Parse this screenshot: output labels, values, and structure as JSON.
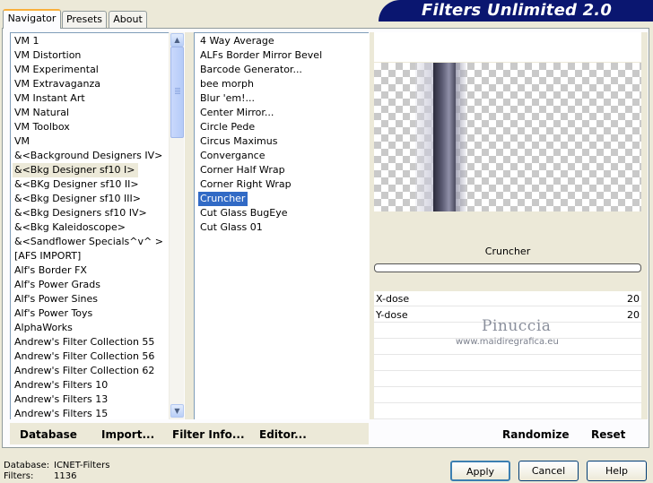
{
  "tabs": [
    "Navigator",
    "Presets",
    "About"
  ],
  "title": "Filters Unlimited 2.0",
  "categories": [
    "VM 1",
    "VM Distortion",
    "VM Experimental",
    "VM Extravaganza",
    "VM Instant Art",
    "VM Natural",
    "VM Toolbox",
    "VM",
    "&<Background Designers IV>",
    "&<Bkg Designer sf10 I>",
    "&<BKg Designer sf10 II>",
    "&<Bkg Designer sf10 III>",
    "&<Bkg Designers sf10 IV>",
    "&<Bkg Kaleidoscope>",
    "&<Sandflower Specials^v^ >",
    "[AFS IMPORT]",
    "Alf's Border FX",
    "Alf's Power Grads",
    "Alf's Power Sines",
    "Alf's Power Toys",
    "AlphaWorks",
    "Andrew's Filter Collection 55",
    "Andrew's Filter Collection 56",
    "Andrew's Filter Collection 62",
    "Andrew's Filters 10",
    "Andrew's Filters 13",
    "Andrew's Filters 15"
  ],
  "selected_category": "&<Bkg Designer sf10 I>",
  "filters": [
    "4 Way Average",
    "ALFs Border Mirror Bevel",
    "Barcode Generator...",
    "bee morph",
    "Blur 'em!...",
    "Center Mirror...",
    "Circle Pede",
    "Circus Maximus",
    "Convergance",
    "Corner Half Wrap",
    "Corner Right Wrap",
    "Cruncher",
    "Cut Glass  BugEye",
    "Cut Glass 01"
  ],
  "selected_filter": "Cruncher",
  "preview": {
    "filter_name": "Cruncher"
  },
  "params": [
    {
      "label": "X-dose",
      "value": "20"
    },
    {
      "label": "Y-dose",
      "value": "20"
    }
  ],
  "watermark": {
    "name": "Pinuccia",
    "url": "www.maidiregrafica.eu"
  },
  "buttons": {
    "database": "Database",
    "import": "Import...",
    "filter_info": "Filter Info...",
    "editor": "Editor...",
    "randomize": "Randomize",
    "reset": "Reset",
    "apply": "Apply",
    "cancel": "Cancel",
    "help": "Help"
  },
  "status": {
    "database_label": "Database:",
    "database_value": "ICNET-Filters",
    "filters_label": "Filters:",
    "filters_value": "1136"
  },
  "icons": {
    "scroll_up": "chevron-up-icon",
    "scroll_down": "chevron-down-icon"
  },
  "colors": {
    "selection": "#316ac5",
    "banner": "#0a1670",
    "tab_highlight": "#f9b03c"
  }
}
